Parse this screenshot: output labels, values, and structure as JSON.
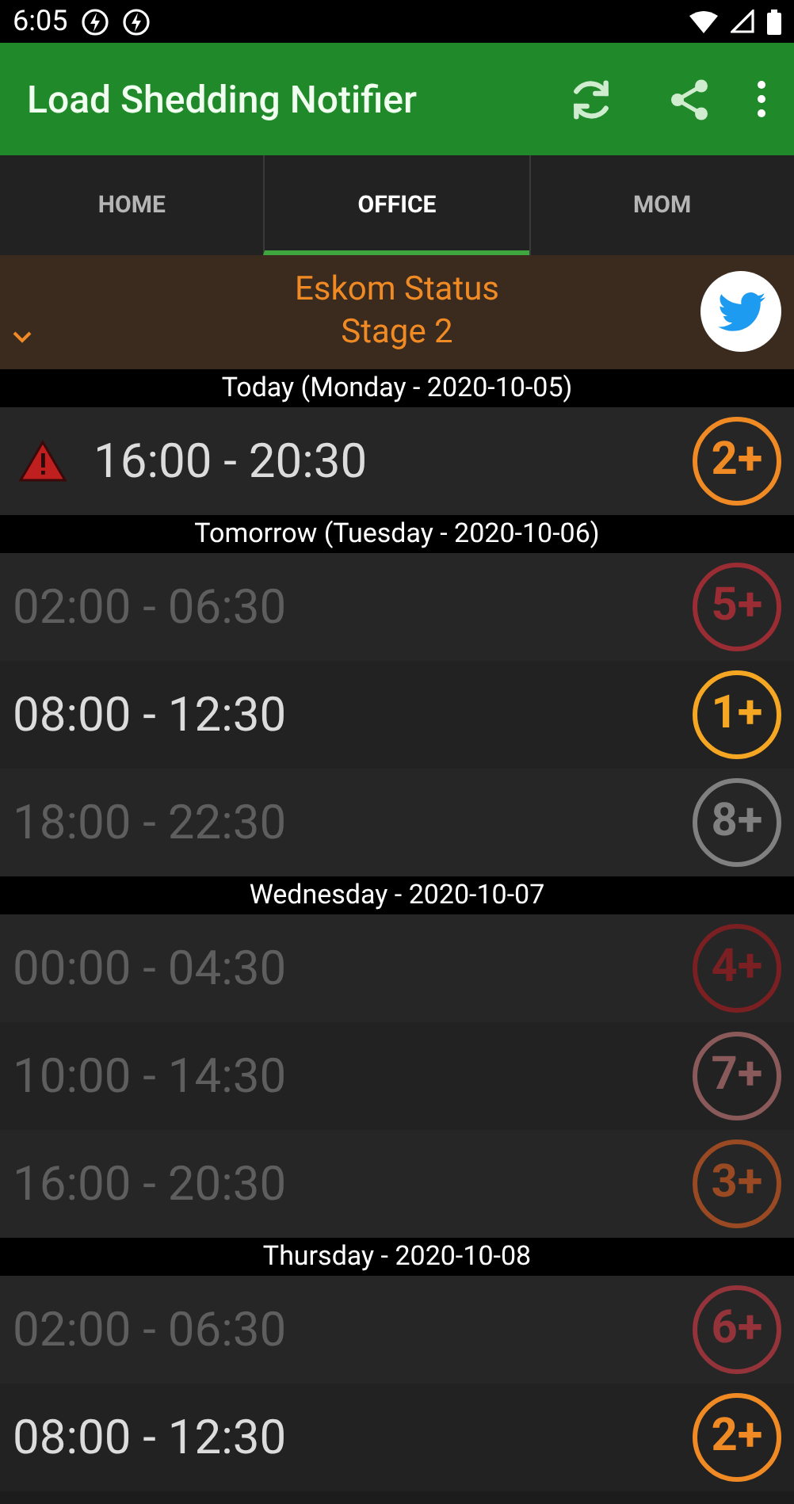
{
  "status_bar": {
    "time": "6:05"
  },
  "app_bar": {
    "title": "Load Shedding Notifier"
  },
  "tabs": [
    {
      "label": "HOME",
      "selected": false
    },
    {
      "label": "OFFICE",
      "selected": true
    },
    {
      "label": "MOM",
      "selected": false
    }
  ],
  "status_banner": {
    "title": "Eskom Status",
    "stage": "Stage 2",
    "expanded": false
  },
  "days": [
    {
      "heading": "Today (Monday - 2020-10-05)",
      "slots": [
        {
          "time": "16:00 - 20:30",
          "stage": "2+",
          "color": "#f08a24",
          "active": true,
          "warning": true
        }
      ]
    },
    {
      "heading": "Tomorrow (Tuesday - 2020-10-06)",
      "slots": [
        {
          "time": "02:00 - 06:30",
          "stage": "5+",
          "color": "#9a2c34",
          "active": false,
          "warning": false
        },
        {
          "time": "08:00 - 12:30",
          "stage": "1+",
          "color": "#f5a623",
          "active": true,
          "warning": false
        },
        {
          "time": "18:00 - 22:30",
          "stage": "8+",
          "color": "#808080",
          "active": false,
          "warning": false
        }
      ]
    },
    {
      "heading": "Wednesday - 2020-10-07",
      "slots": [
        {
          "time": "00:00 - 04:30",
          "stage": "4+",
          "color": "#7a1f22",
          "active": false,
          "warning": false
        },
        {
          "time": "10:00 - 14:30",
          "stage": "7+",
          "color": "#8a5a5a",
          "active": false,
          "warning": false
        },
        {
          "time": "16:00 - 20:30",
          "stage": "3+",
          "color": "#9a4a22",
          "active": false,
          "warning": false
        }
      ]
    },
    {
      "heading": "Thursday - 2020-10-08",
      "slots": [
        {
          "time": "02:00 - 06:30",
          "stage": "6+",
          "color": "#94343a",
          "active": false,
          "warning": false
        },
        {
          "time": "08:00 - 12:30",
          "stage": "2+",
          "color": "#f08a24",
          "active": true,
          "warning": false
        }
      ]
    }
  ]
}
